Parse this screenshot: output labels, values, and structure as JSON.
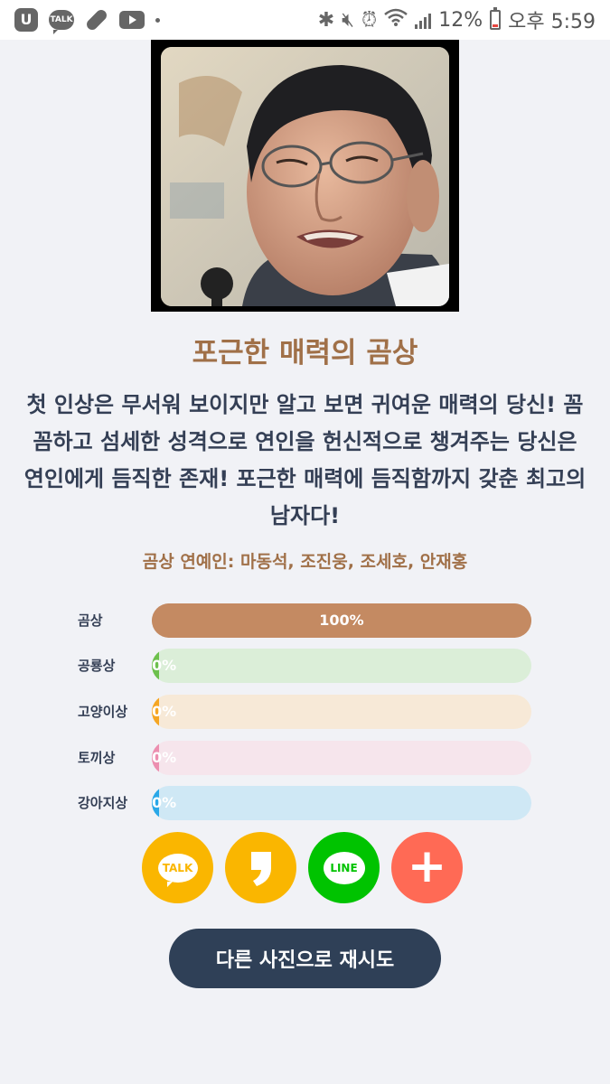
{
  "status_bar": {
    "talk_icon_label": "TALK",
    "u_icon_label": "U",
    "battery_percent": "12%",
    "time": "오후 5:59",
    "battery_level": 0.12,
    "icons": [
      "u-plus-icon",
      "kakaotalk-icon",
      "pill-icon",
      "youtube-icon",
      "dot-icon",
      "bluetooth-icon",
      "mute-icon",
      "alarm-icon",
      "wifi-icon",
      "signal-icon",
      "battery-icon"
    ]
  },
  "result": {
    "title": "포근한 매력의 곰상",
    "description": "첫 인상은 무서워 보이지만 알고 보면 귀여운 매력의 당신! 꼼꼼하고 섬세한 성격으로 연인을 헌신적으로 챙겨주는 당신은 연인에게 듬직한 존재! 포근한 매력에 듬직함까지 갖춘 최고의 남자다!",
    "celebrities": "곰상 연예인: 마동석, 조진웅, 조세호, 안재홍"
  },
  "scores": [
    {
      "label": "곰상",
      "value": 100,
      "text": "100%",
      "color": "#c48a62",
      "track": "#c48a62"
    },
    {
      "label": "공룡상",
      "value": 0,
      "text": "0%",
      "color": "#6dc04d",
      "track": "#dbeed8"
    },
    {
      "label": "고양이상",
      "value": 0,
      "text": "0%",
      "color": "#f5a623",
      "track": "#f7e9d7"
    },
    {
      "label": "토끼상",
      "value": 0,
      "text": "0%",
      "color": "#ec8fb0",
      "track": "#f6e5ec"
    },
    {
      "label": "강아지상",
      "value": 0,
      "text": "0%",
      "color": "#2aa8e8",
      "track": "#cfe8f5"
    }
  ],
  "share": {
    "talk_label": "TALK",
    "story_label": "❜",
    "line_label": "LINE",
    "more_label": "+",
    "colors": {
      "kakao": "#fab600",
      "line": "#00c300",
      "more": "#ff6a55"
    }
  },
  "retry_button": "다른 사진으로 재시도"
}
